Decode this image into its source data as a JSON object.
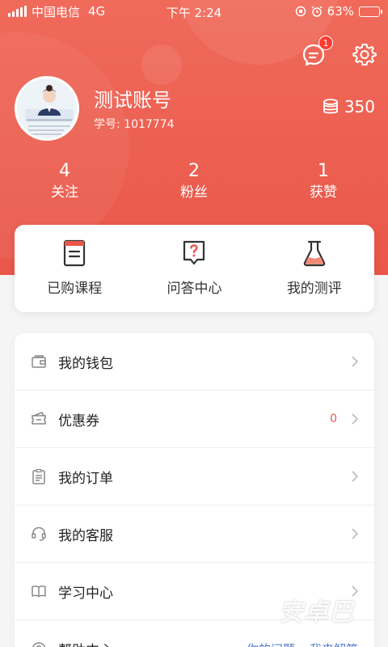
{
  "status_bar": {
    "carrier": "中国电信",
    "network": "4G",
    "time": "下午 2:24",
    "battery": "63%",
    "battery_level": 0.63
  },
  "header": {
    "message_badge": "1"
  },
  "profile": {
    "username": "测试账号",
    "student_id": "学号: 1017774",
    "coins": "350"
  },
  "stats": [
    {
      "value": "4",
      "label": "关注"
    },
    {
      "value": "2",
      "label": "粉丝"
    },
    {
      "value": "1",
      "label": "获赞"
    }
  ],
  "quick_actions": [
    {
      "label": "已购课程",
      "icon": "book-icon"
    },
    {
      "label": "问答中心",
      "icon": "question-chat-icon"
    },
    {
      "label": "我的测评",
      "icon": "flask-icon"
    }
  ],
  "menu": [
    {
      "label": "我的钱包",
      "icon": "wallet-icon"
    },
    {
      "label": "优惠券",
      "icon": "coupon-icon",
      "count": "0"
    },
    {
      "label": "我的订单",
      "icon": "clipboard-icon"
    },
    {
      "label": "我的客服",
      "icon": "headset-icon"
    },
    {
      "label": "学习中心",
      "icon": "open-book-icon"
    },
    {
      "label": "帮助中心",
      "icon": "help-icon",
      "links": [
        "你的问题",
        "我来解答"
      ]
    }
  ],
  "watermark": "安卓巴",
  "colors": {
    "brand": "#e9574a",
    "link": "#4a74c9"
  }
}
